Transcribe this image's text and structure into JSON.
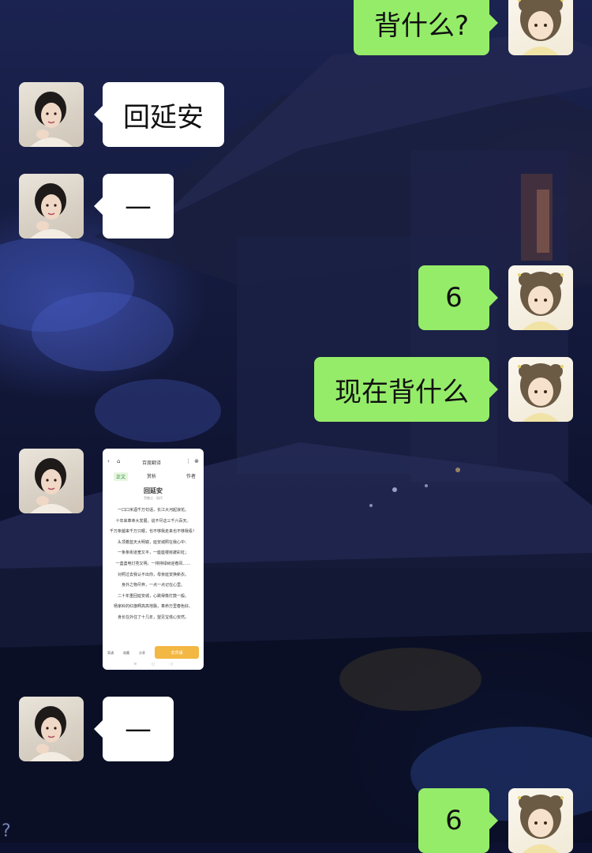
{
  "messages": [
    {
      "side": "right",
      "text": "背什么?"
    },
    {
      "side": "left",
      "text": "回延安"
    },
    {
      "side": "left",
      "text": "—"
    },
    {
      "side": "right",
      "text": "6"
    },
    {
      "side": "right",
      "text": "现在背什么"
    },
    {
      "side": "left",
      "type": "image"
    },
    {
      "side": "left",
      "text": "—"
    },
    {
      "side": "right",
      "text": "6"
    }
  ],
  "shared_image": {
    "app_title": "百度翻译",
    "tabs": [
      "正文",
      "赏析",
      "作者"
    ],
    "poem_title": "回延安",
    "poem_meta": "贺敬之 · 现代",
    "lines": [
      "一口口米酒千万句话，长江大河起浪花。",
      "十年来革命大发展，说不尽这三千六百天。",
      "千万条腿来千万只眼，也不够我走来也不够我看！",
      "头顶着蓝天大明镜，延安城照在我心中：",
      "一条条街道宽又平，一座座楼房披彩虹；",
      "一盏盏电灯亮又明，一排排绿树迎春风……",
      "对照过去我认不出你，母亲延安换新衣。",
      "身外之物尽弃，一点一点记在心里。",
      "二十年重回延安城，心跳得像打鼓一般。",
      "杨家岭的红旗啊高高地飘，革命万里春色好。",
      "身长在外住了十几年，望见宝塔心安然。"
    ],
    "bottom_actions": [
      "背诵",
      "收藏",
      "分享"
    ],
    "bottom_button": "去背诵"
  },
  "corner_glyph": "?"
}
